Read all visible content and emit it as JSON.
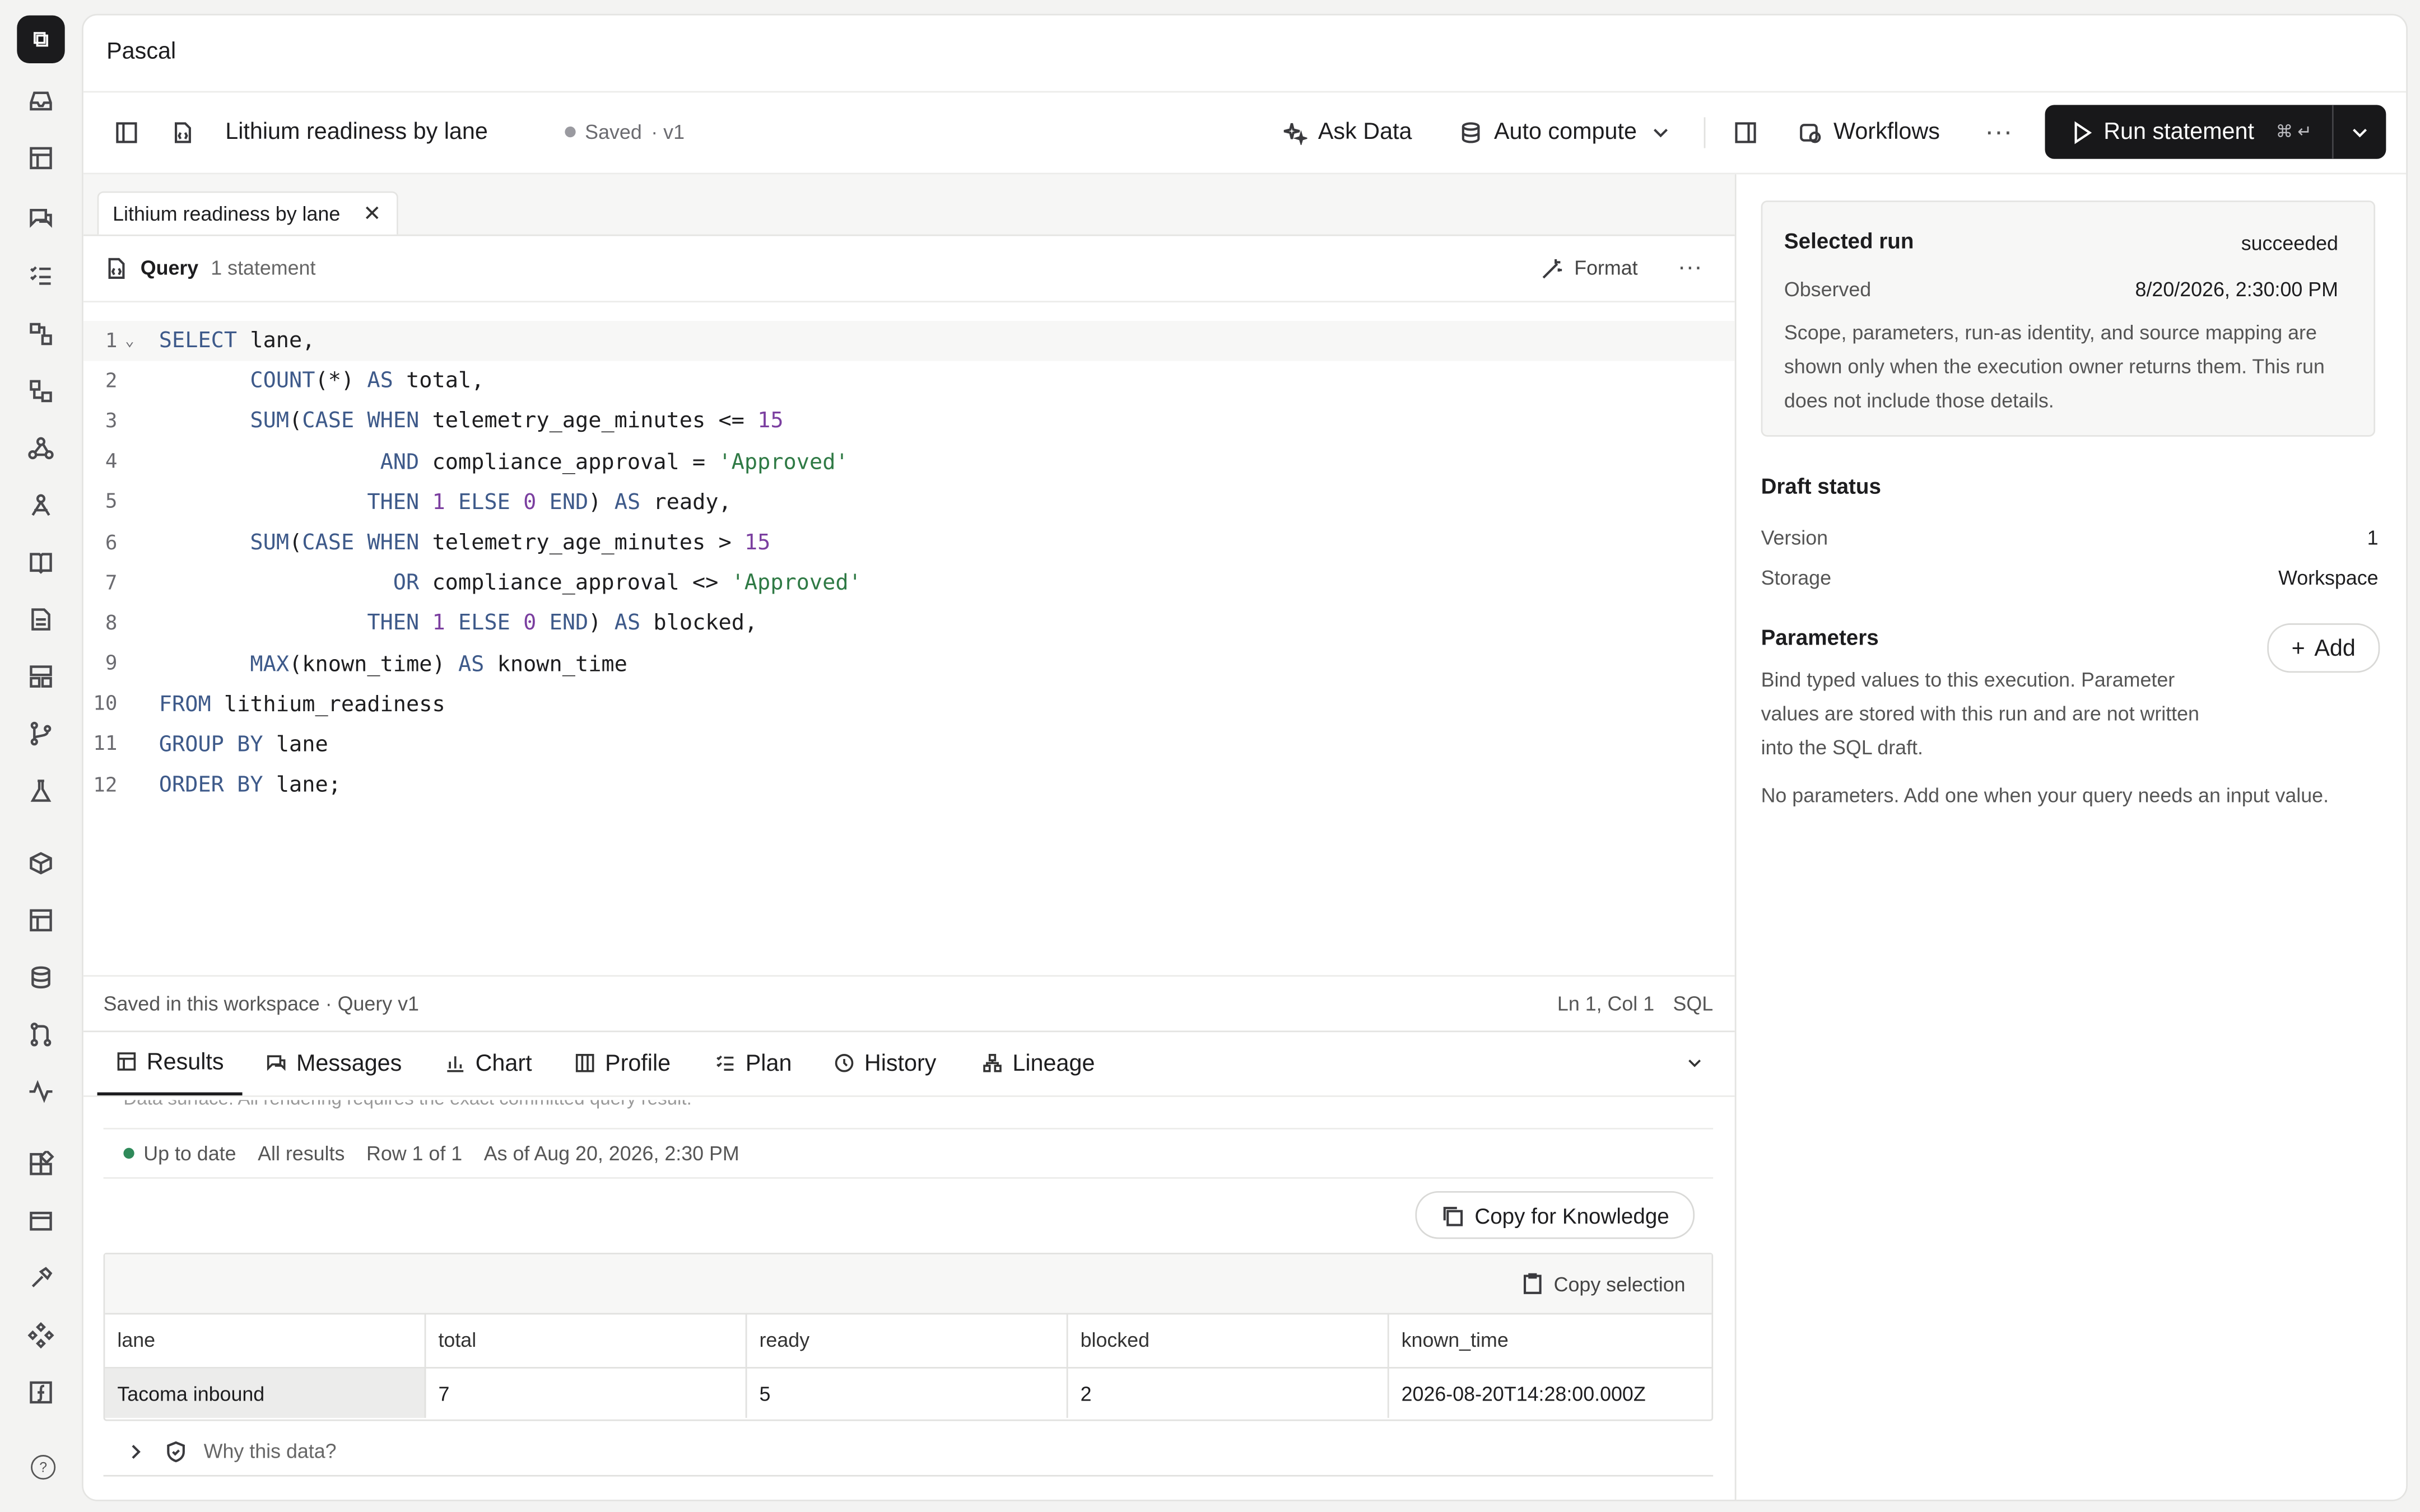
{
  "app": {
    "title": "Pascal"
  },
  "toolbar": {
    "doc_title": "Lithium readiness by lane",
    "saved_label": "Saved",
    "version_label": "· v1",
    "ask_data": "Ask Data",
    "auto_compute": "Auto compute",
    "workflows": "Workflows",
    "run_label": "Run statement",
    "run_shortcut": "⌘ ↵"
  },
  "editor": {
    "tab_label": "Lithium readiness by lane",
    "query_label": "Query",
    "statement_count": "1 statement",
    "format_label": "Format",
    "status_left": "Saved in this workspace · Query v1",
    "cursor": "Ln 1, Col 1",
    "language": "SQL",
    "lines": [
      "SELECT lane,",
      "       COUNT(*) AS total,",
      "       SUM(CASE WHEN telemetry_age_minutes <= 15",
      "                 AND compliance_approval = 'Approved'",
      "                THEN 1 ELSE 0 END) AS ready,",
      "       SUM(CASE WHEN telemetry_age_minutes > 15",
      "                  OR compliance_approval <> 'Approved'",
      "                THEN 1 ELSE 0 END) AS blocked,",
      "       MAX(known_time) AS known_time",
      "FROM lithium_readiness",
      "GROUP BY lane",
      "ORDER BY lane;"
    ]
  },
  "results": {
    "tabs": [
      "Results",
      "Messages",
      "Chart",
      "Profile",
      "Plan",
      "History",
      "Lineage"
    ],
    "cut_text": "Data surface: All rendering requires the exact committed query result.",
    "status": "Up to date",
    "scope": "All results",
    "rows": "Row 1 of 1",
    "as_of": "As of Aug 20, 2026, 2:30 PM",
    "copy_knowledge": "Copy for Knowledge",
    "copy_selection": "Copy selection",
    "columns": [
      "lane",
      "total",
      "ready",
      "blocked",
      "known_time"
    ],
    "data": [
      [
        "Tacoma inbound",
        "7",
        "5",
        "2",
        "2026-08-20T14:28:00.000Z"
      ]
    ],
    "why": "Why this data?"
  },
  "side": {
    "selected_run": "Selected run",
    "run_status": "succeeded",
    "observed_label": "Observed",
    "observed_value": "8/20/2026, 2:30:00 PM",
    "run_desc": "Scope, parameters, run-as identity, and source mapping are shown only when the execution owner returns them. This run does not include those details.",
    "draft_status": "Draft status",
    "version_label": "Version",
    "version_value": "1",
    "storage_label": "Storage",
    "storage_value": "Workspace",
    "parameters": "Parameters",
    "add": "Add",
    "param_desc": "Bind typed values to this execution. Parameter values are stored with this run and are not written into the SQL draft.",
    "no_params": "No parameters. Add one when your query needs an input value."
  }
}
